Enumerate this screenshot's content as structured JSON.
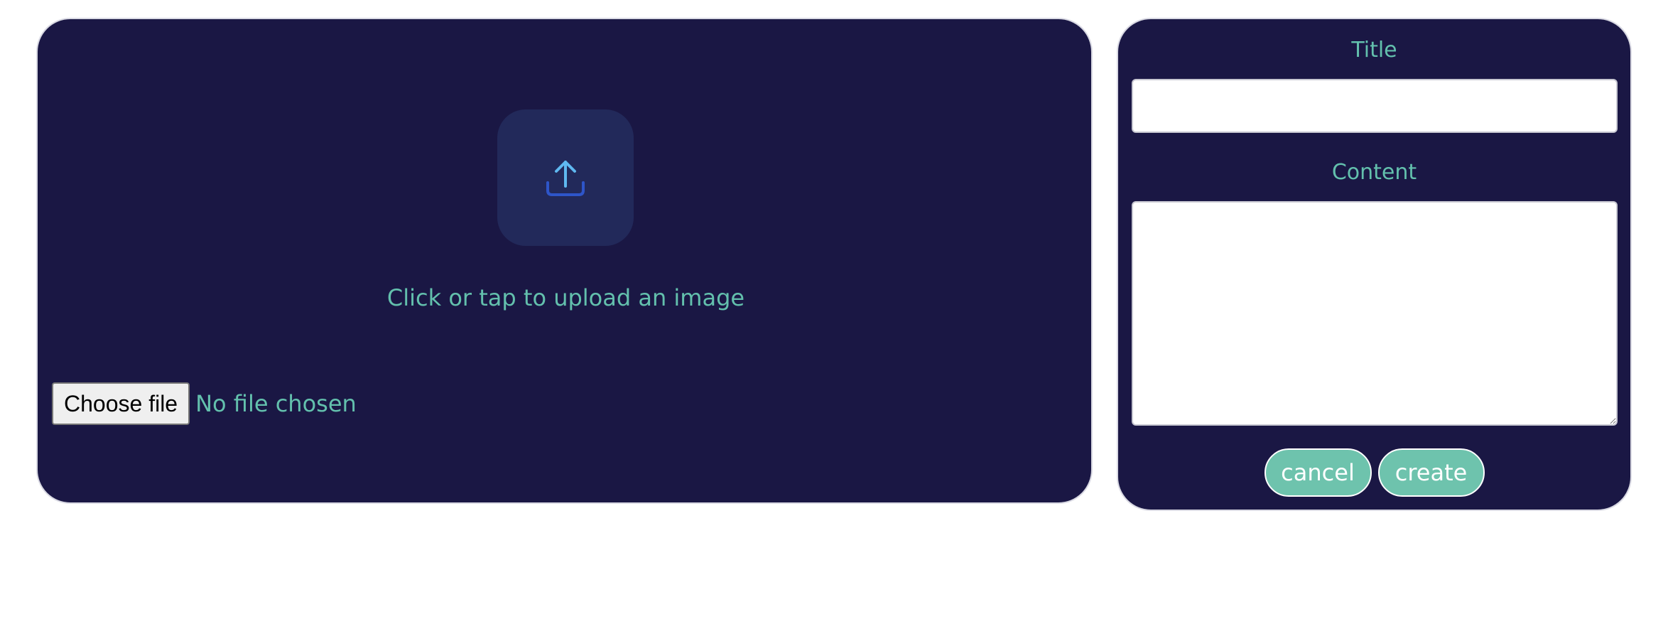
{
  "upload": {
    "icon": "upload-tray-icon",
    "caption": "Click or tap to upload an image",
    "choose_file_label": "Choose file",
    "file_status": "No file chosen"
  },
  "form": {
    "title_label": "Title",
    "title_value": "",
    "content_label": "Content",
    "content_value": "",
    "cancel_label": "cancel",
    "create_label": "create"
  },
  "colors": {
    "panel_background": "#1a1744",
    "accent_text": "#63c0ad",
    "button_fill": "#6ec3ad",
    "icon_tile": "#22295a",
    "icon_arrow": "#5fb8f0",
    "icon_tray": "#2e55c9"
  }
}
